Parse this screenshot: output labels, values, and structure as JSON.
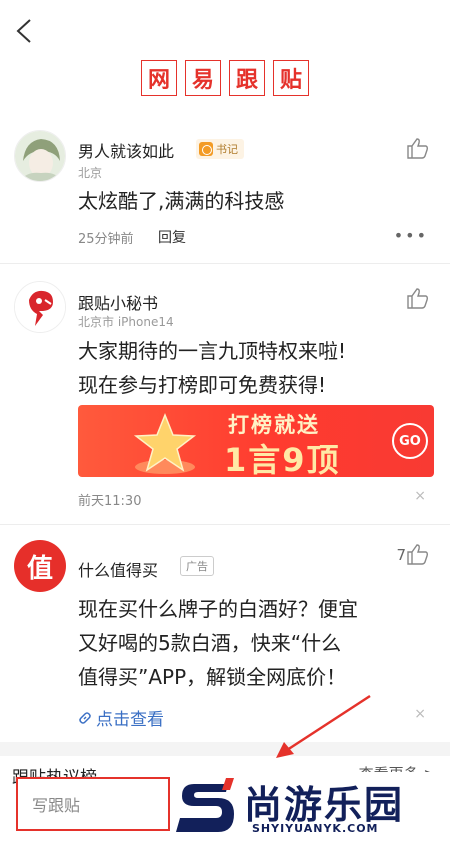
{
  "header": {
    "title_chars": [
      "网",
      "易",
      "跟",
      "贴"
    ]
  },
  "comments": [
    {
      "name": "男人就该如此",
      "badge": "书记",
      "location": "北京",
      "text": "太炫酷了,满满的科技感",
      "time": "25分钟前",
      "reply": "回复",
      "more": "•••"
    },
    {
      "name": "跟贴小秘书",
      "location": "北京市 iPhone14",
      "text_lines": [
        "大家期待的一言九顶特权来啦!",
        "现在参与打榜即可免费获得!"
      ],
      "banner_top": "打榜就送",
      "banner_main": "1言9顶",
      "banner_button": "GO",
      "time": "前天11:30",
      "close": "×"
    },
    {
      "name": "什么值得买",
      "ad_label": "广告",
      "avatar_char": "值",
      "likes": "7",
      "text_lines": [
        "现在买什么牌子的白酒好？便宜",
        "又好喝的5款白酒，快来“什么",
        "值得买”APP，解锁全网底价！"
      ],
      "link": "点击查看",
      "close": "×"
    }
  ],
  "hot": {
    "title": "跟贴热议榜",
    "more": "查看更多 >"
  },
  "footer": {
    "input_placeholder": "写跟贴"
  },
  "watermark": {
    "brand": "尚游乐园",
    "url": "SHYIYUANYK.COM"
  },
  "colors": {
    "accent": "#e5322b",
    "link": "#3a6fc4",
    "brand_navy": "#12205a"
  }
}
